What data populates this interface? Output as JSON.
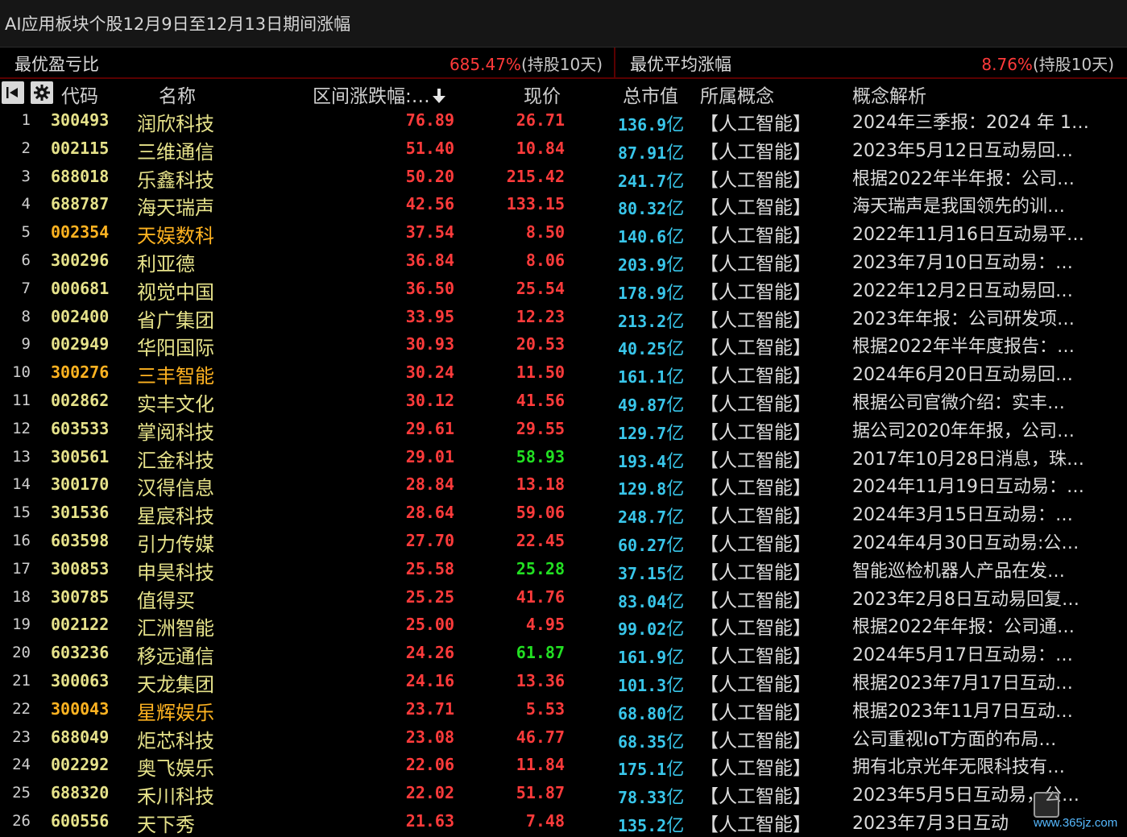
{
  "window": {
    "title": "AI应用板块个股12月9日至12月13日期间涨幅"
  },
  "summary": {
    "left_label": "最优盈亏比",
    "left_value": "685.47%",
    "left_note": "(持股10天)",
    "right_label": "最优平均涨幅",
    "right_value": "8.76%",
    "right_note": "(持股10天)"
  },
  "header": {
    "code": "代码",
    "name": "名称",
    "change": "区间涨跌幅:…",
    "price": "现价",
    "market_cap": "总市值",
    "concept": "所属概念",
    "analysis": "概念解析"
  },
  "colors": {
    "code_normal": "#e6e28a",
    "code_special": "#ffb321",
    "up_red": "#ff3b3b",
    "down_green": "#22e022",
    "cap_cyan": "#39c6ea"
  },
  "rows": [
    {
      "idx": "1",
      "code": "300493",
      "name": "润欣科技",
      "change": "76.89",
      "price": "26.71",
      "cap": "136.9",
      "unit": "亿",
      "concept": "【人工智能】",
      "desc": "2024年三季报：2024 年 1…"
    },
    {
      "idx": "2",
      "code": "002115",
      "name": "三维通信",
      "change": "51.40",
      "price": "10.84",
      "cap": "87.91",
      "unit": "亿",
      "concept": "【人工智能】",
      "desc": "2023年5月12日互动易回…"
    },
    {
      "idx": "3",
      "code": "688018",
      "name": "乐鑫科技",
      "change": "50.20",
      "price": "215.42",
      "cap": "241.7",
      "unit": "亿",
      "concept": "【人工智能】",
      "desc": "根据2022年半年报：公司…"
    },
    {
      "idx": "4",
      "code": "688787",
      "name": "海天瑞声",
      "change": "42.56",
      "price": "133.15",
      "cap": "80.32",
      "unit": "亿",
      "concept": "【人工智能】",
      "desc": "海天瑞声是我国领先的训…"
    },
    {
      "idx": "5",
      "code": "002354",
      "name": "天娱数科",
      "change": "37.54",
      "price": "8.50",
      "cap": "140.6",
      "unit": "亿",
      "concept": "【人工智能】",
      "desc": "2022年11月16日互动易平…",
      "special": true
    },
    {
      "idx": "6",
      "code": "300296",
      "name": "利亚德",
      "change": "36.84",
      "price": "8.06",
      "cap": "203.9",
      "unit": "亿",
      "concept": "【人工智能】",
      "desc": "2023年7月10日互动易：…"
    },
    {
      "idx": "7",
      "code": "000681",
      "name": "视觉中国",
      "change": "36.50",
      "price": "25.54",
      "cap": "178.9",
      "unit": "亿",
      "concept": "【人工智能】",
      "desc": "2022年12月2日互动易回…"
    },
    {
      "idx": "8",
      "code": "002400",
      "name": "省广集团",
      "change": "33.95",
      "price": "12.23",
      "cap": "213.2",
      "unit": "亿",
      "concept": "【人工智能】",
      "desc": "2023年年报：公司研发项…"
    },
    {
      "idx": "9",
      "code": "002949",
      "name": "华阳国际",
      "change": "30.93",
      "price": "20.53",
      "cap": "40.25",
      "unit": "亿",
      "concept": "【人工智能】",
      "desc": "根据2022年半年度报告：…"
    },
    {
      "idx": "10",
      "code": "300276",
      "name": "三丰智能",
      "change": "30.24",
      "price": "11.50",
      "cap": "161.1",
      "unit": "亿",
      "concept": "【人工智能】",
      "desc": "2024年6月20日互动易回…",
      "special": true
    },
    {
      "idx": "11",
      "code": "002862",
      "name": "实丰文化",
      "change": "30.12",
      "price": "41.56",
      "cap": "49.87",
      "unit": "亿",
      "concept": "【人工智能】",
      "desc": "根据公司官微介绍：实丰…"
    },
    {
      "idx": "12",
      "code": "603533",
      "name": "掌阅科技",
      "change": "29.61",
      "price": "29.55",
      "cap": "129.7",
      "unit": "亿",
      "concept": "【人工智能】",
      "desc": "据公司2020年年报，公司…"
    },
    {
      "idx": "13",
      "code": "300561",
      "name": "汇金科技",
      "change": "29.01",
      "price": "58.93",
      "cap": "193.4",
      "unit": "亿",
      "concept": "【人工智能】",
      "desc": "2017年10月28日消息，珠…",
      "price_green": true
    },
    {
      "idx": "14",
      "code": "300170",
      "name": "汉得信息",
      "change": "28.84",
      "price": "13.18",
      "cap": "129.8",
      "unit": "亿",
      "concept": "【人工智能】",
      "desc": "2024年11月19日互动易：…"
    },
    {
      "idx": "15",
      "code": "301536",
      "name": "星宸科技",
      "change": "28.64",
      "price": "59.06",
      "cap": "248.7",
      "unit": "亿",
      "concept": "【人工智能】",
      "desc": "2024年3月15日互动易：…"
    },
    {
      "idx": "16",
      "code": "603598",
      "name": "引力传媒",
      "change": "27.70",
      "price": "22.45",
      "cap": "60.27",
      "unit": "亿",
      "concept": "【人工智能】",
      "desc": "2024年4月30日互动易:公…"
    },
    {
      "idx": "17",
      "code": "300853",
      "name": "申昊科技",
      "change": "25.58",
      "price": "25.28",
      "cap": "37.15",
      "unit": "亿",
      "concept": "【人工智能】",
      "desc": "智能巡检机器人产品在发…",
      "price_green": true
    },
    {
      "idx": "18",
      "code": "300785",
      "name": "值得买",
      "change": "25.25",
      "price": "41.76",
      "cap": "83.04",
      "unit": "亿",
      "concept": "【人工智能】",
      "desc": "2023年2月8日互动易回复…"
    },
    {
      "idx": "19",
      "code": "002122",
      "name": "汇洲智能",
      "change": "25.00",
      "price": "4.95",
      "cap": "99.02",
      "unit": "亿",
      "concept": "【人工智能】",
      "desc": "根据2022年年报：公司通…"
    },
    {
      "idx": "20",
      "code": "603236",
      "name": "移远通信",
      "change": "24.26",
      "price": "61.87",
      "cap": "161.9",
      "unit": "亿",
      "concept": "【人工智能】",
      "desc": "2024年5月17日互动易：…",
      "price_green": true
    },
    {
      "idx": "21",
      "code": "300063",
      "name": "天龙集团",
      "change": "24.16",
      "price": "13.36",
      "cap": "101.3",
      "unit": "亿",
      "concept": "【人工智能】",
      "desc": "根据2023年7月17日互动…"
    },
    {
      "idx": "22",
      "code": "300043",
      "name": "星辉娱乐",
      "change": "23.71",
      "price": "5.53",
      "cap": "68.80",
      "unit": "亿",
      "concept": "【人工智能】",
      "desc": "根据2023年11月7日互动…",
      "special": true
    },
    {
      "idx": "23",
      "code": "688049",
      "name": "炬芯科技",
      "change": "23.08",
      "price": "46.77",
      "cap": "68.35",
      "unit": "亿",
      "concept": "【人工智能】",
      "desc": "公司重视IoT方面的布局…"
    },
    {
      "idx": "24",
      "code": "002292",
      "name": "奥飞娱乐",
      "change": "22.06",
      "price": "11.84",
      "cap": "175.1",
      "unit": "亿",
      "concept": "【人工智能】",
      "desc": "拥有北京光年无限科技有…"
    },
    {
      "idx": "25",
      "code": "688320",
      "name": "禾川科技",
      "change": "22.02",
      "price": "51.87",
      "cap": "78.33",
      "unit": "亿",
      "concept": "【人工智能】",
      "desc": "2023年5月5日互动易，公…"
    },
    {
      "idx": "26",
      "code": "600556",
      "name": "天下秀",
      "change": "21.63",
      "price": "7.48",
      "cap": "135.2",
      "unit": "亿",
      "concept": "【人工智能】",
      "desc": "2023年7月3日互动"
    }
  ],
  "watermark": {
    "url": "www.365jz.com"
  }
}
